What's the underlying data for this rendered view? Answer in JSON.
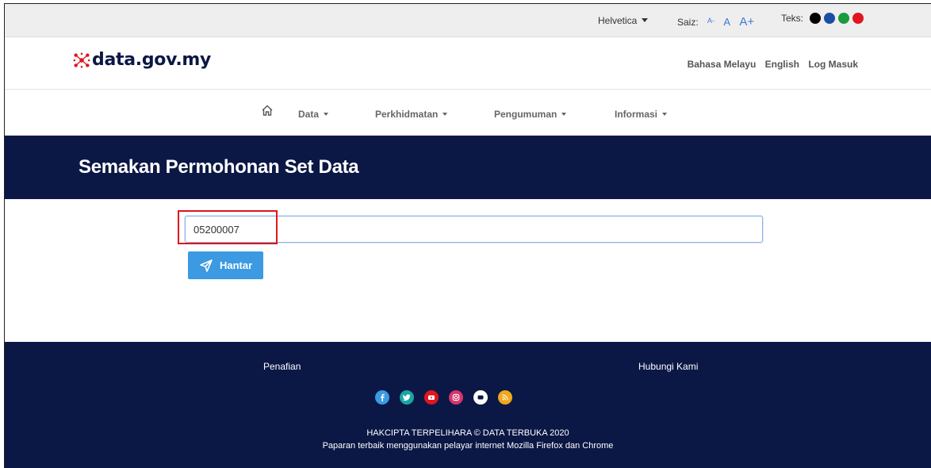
{
  "access_bar": {
    "font_select": "Helvetica",
    "size_label": "Saiz:",
    "size_small": "A-",
    "size_normal": "A",
    "size_large": "A+",
    "text_label": "Teks:",
    "text_colors": [
      "#000000",
      "#1a4fa3",
      "#1a9b3e",
      "#e0151d"
    ]
  },
  "header": {
    "logo_text": "data.gov.my",
    "lang_malay": "Bahasa Melayu",
    "lang_english": "English",
    "login": "Log Masuk"
  },
  "nav": {
    "items": [
      "Data",
      "Perkhidmatan",
      "Pengumuman",
      "Informasi"
    ]
  },
  "page_title": "Semakan Permohonan Set Data",
  "form": {
    "input_value": "05200007",
    "submit_label": "Hantar"
  },
  "footer": {
    "disclaimer": "Penafian",
    "contact": "Hubungi Kami",
    "socials": [
      "facebook-icon",
      "twitter-icon",
      "youtube-icon",
      "instagram-icon",
      "flickr-icon",
      "rss-icon"
    ],
    "copyright": "HAKCIPTA TERPELIHARA © DATA TERBUKA 2020",
    "best_view": "Paparan terbaik menggunakan pelayar internet Mozilla Firefox dan Chrome"
  },
  "colors": {
    "brand_navy": "#0b1845",
    "accent_blue": "#3b9ae1",
    "highlight_red": "#e0151d"
  }
}
